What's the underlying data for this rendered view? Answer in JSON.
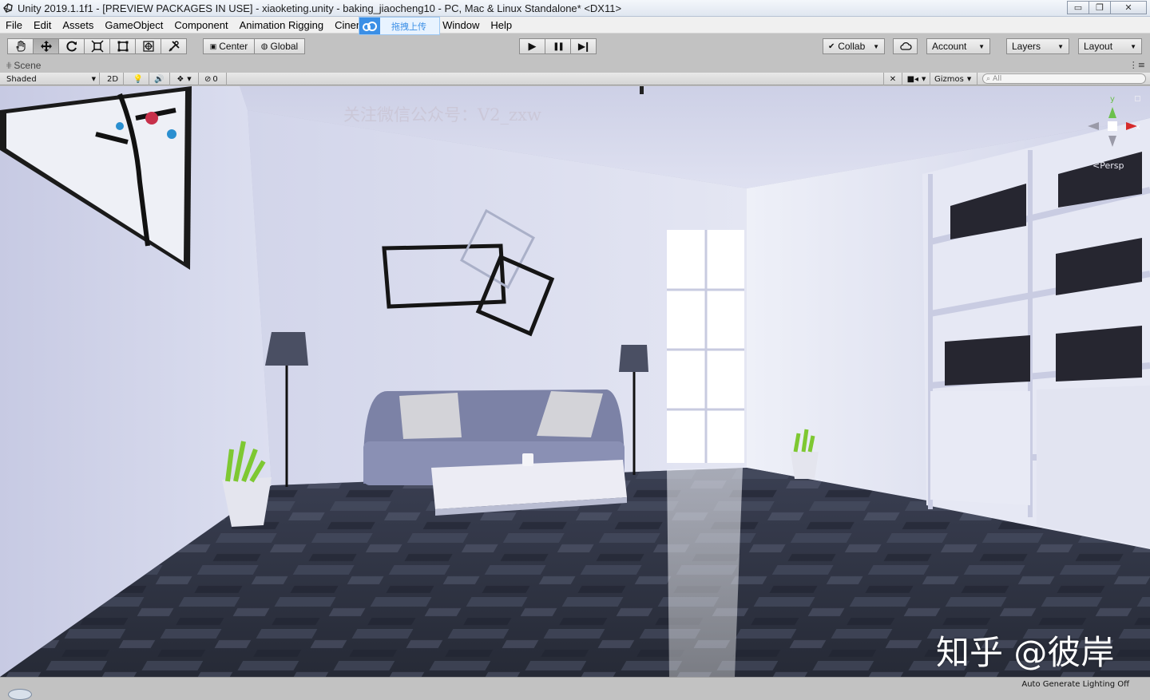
{
  "window": {
    "title": "Unity 2019.1.1f1 - [PREVIEW PACKAGES IN USE] - xiaoketing.unity - baking_jiaocheng10 - PC, Mac & Linux Standalone* <DX11>",
    "controls": {
      "minimize": "▭",
      "maximize": "❐",
      "close": "✕"
    }
  },
  "menubar": {
    "items": [
      "File",
      "Edit",
      "Assets",
      "GameObject",
      "Component",
      "Animation Rigging",
      "Cinem",
      "Window",
      "Help"
    ],
    "popup_label": "拖拽上传"
  },
  "toolbar": {
    "tools": [
      {
        "name": "hand-tool",
        "icon": "hand-icon"
      },
      {
        "name": "move-tool",
        "icon": "move-icon"
      },
      {
        "name": "rotate-tool",
        "icon": "rotate-icon"
      },
      {
        "name": "scale-tool",
        "icon": "scale-icon"
      },
      {
        "name": "rect-tool",
        "icon": "rect-icon"
      },
      {
        "name": "transform-tool",
        "icon": "transform-icon"
      },
      {
        "name": "custom-tool",
        "icon": "wrench-icon"
      }
    ],
    "active_tool": "move-tool",
    "pivot_label": "Center",
    "space_label": "Global",
    "play_icon": "▶",
    "pause_icon": "❚❚",
    "step_icon": "▶❙",
    "collab_label": "Collab",
    "account_label": "Account",
    "layers_label": "Layers",
    "layout_label": "Layout"
  },
  "scene_tab": {
    "label": "Scene",
    "menu_icon": "⋮≡"
  },
  "scene_controls": {
    "draw_mode": "Shaded",
    "mode_2d": "2D",
    "hidden_count": "0",
    "gizmos_label": "Gizmos",
    "search_placeholder": "All"
  },
  "viewport": {
    "watermark": "关注微信公众号：V2_zxw",
    "brand_watermark": "知乎 @彼岸",
    "projection": "Persp",
    "gizmo_axes": {
      "x": "x",
      "y": "y"
    }
  },
  "statusbar": {
    "text": "Auto Generate Lighting Off"
  },
  "colors": {
    "editor_gray": "#c2c2c2",
    "wall": "#d9dcee",
    "floor": "#2c3140",
    "gizmo_y": "#6bc04b",
    "gizmo_x": "#d62b2b"
  }
}
